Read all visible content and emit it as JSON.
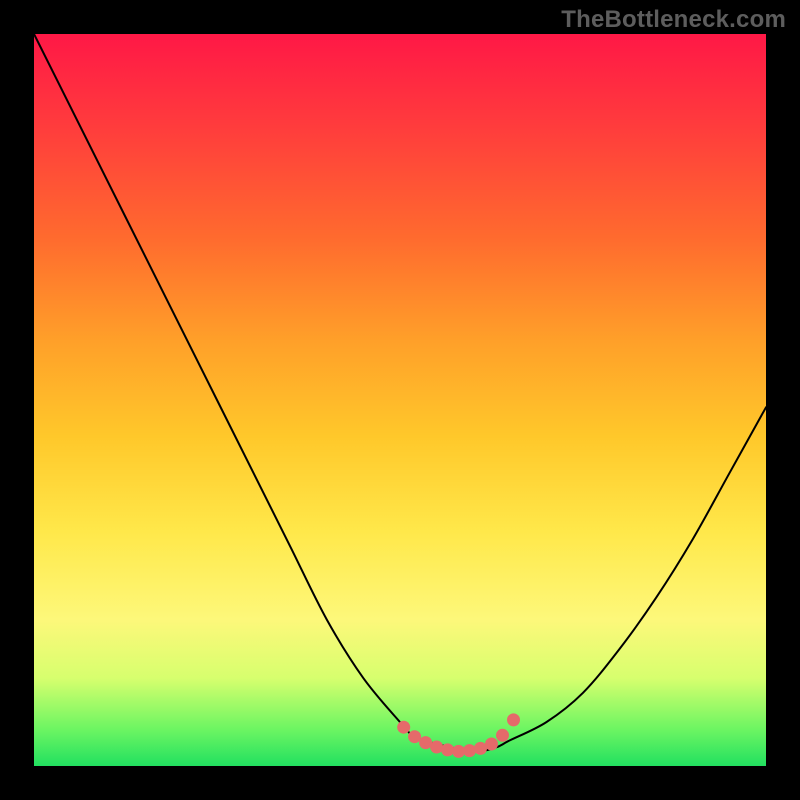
{
  "watermark": "TheBottleneck.com",
  "chart_data": {
    "type": "line",
    "title": "",
    "xlabel": "",
    "ylabel": "",
    "xlim": [
      0,
      100
    ],
    "ylim": [
      0,
      100
    ],
    "series": [
      {
        "name": "bottleneck-curve",
        "x": [
          0,
          5,
          10,
          15,
          20,
          25,
          30,
          35,
          40,
          45,
          50,
          52,
          55,
          60,
          63,
          65,
          70,
          75,
          80,
          85,
          90,
          95,
          100
        ],
        "y": [
          100,
          90,
          80,
          70,
          60,
          50,
          40,
          30,
          20,
          12,
          6,
          4,
          3,
          2,
          2.5,
          3.5,
          6,
          10,
          16,
          23,
          31,
          40,
          49
        ]
      }
    ],
    "markers": {
      "name": "highlight-dots",
      "color": "#e56a6a",
      "x": [
        50.5,
        52,
        53.5,
        55,
        56.5,
        58,
        59.5,
        61,
        62.5,
        64,
        65.5
      ],
      "y": [
        5.3,
        4.0,
        3.2,
        2.6,
        2.2,
        2.0,
        2.1,
        2.4,
        3.0,
        4.2,
        6.3
      ]
    }
  },
  "colors": {
    "curve": "#000000",
    "marker": "#e56a6a",
    "background_black": "#000000"
  }
}
